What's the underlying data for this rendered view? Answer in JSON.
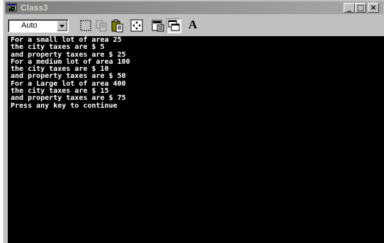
{
  "window": {
    "title": "Class3"
  },
  "toolbar": {
    "font_size_value": "Auto",
    "font_button_label": "A",
    "tools": [
      {
        "icon": "mark-icon"
      },
      {
        "icon": "copy-icon"
      },
      {
        "icon": "paste-icon"
      },
      {
        "icon": "fullscreen-icon"
      },
      {
        "icon": "properties-icon"
      },
      {
        "icon": "background-icon"
      },
      {
        "icon": "font-icon"
      }
    ]
  },
  "title_buttons": {
    "minimize": "_",
    "maximize": "□",
    "close": "×"
  },
  "console": {
    "lines": [
      "For a small lot of area 25",
      "the city taxes are $ 5",
      "and property taxes are $ 25",
      "For a medium lot of area 100",
      "the city taxes are $ 10",
      "and property taxes are $ 50",
      "For a Large lot of area 400",
      "the city taxes are $ 15",
      "and property taxes are $ 75",
      "Press any key to continue"
    ]
  },
  "colors": {
    "console_bg": "#000000",
    "console_fg": "#ffffff",
    "titlebar_inactive": "#808080",
    "chrome": "#c0c0c0"
  }
}
